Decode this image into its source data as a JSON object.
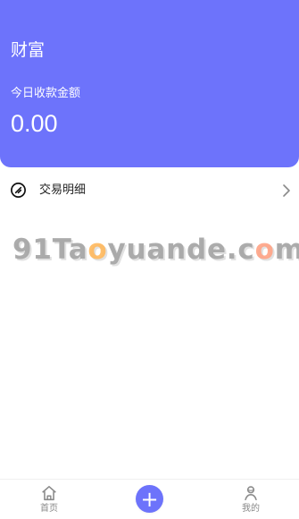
{
  "header": {
    "title": "财富",
    "today_label": "今日收款金额",
    "today_amount": "0.00"
  },
  "main": {
    "transaction_detail_label": "交易明细"
  },
  "watermark": {
    "part1": "91Ta",
    "o1": "o",
    "part2": "yuande.c",
    "o2": "o",
    "part3": "m"
  },
  "tabbar": {
    "home_label": "首页",
    "add_label": "+",
    "me_label": "我的"
  },
  "colors": {
    "primary": "#6d73fb",
    "text_dark": "#1f1f1f",
    "text_muted": "#888888"
  },
  "icons": {
    "transaction": "circle-slash-icon",
    "chevron": "chevron-right-icon",
    "home": "home-icon",
    "add": "plus-icon",
    "profile": "user-icon"
  }
}
